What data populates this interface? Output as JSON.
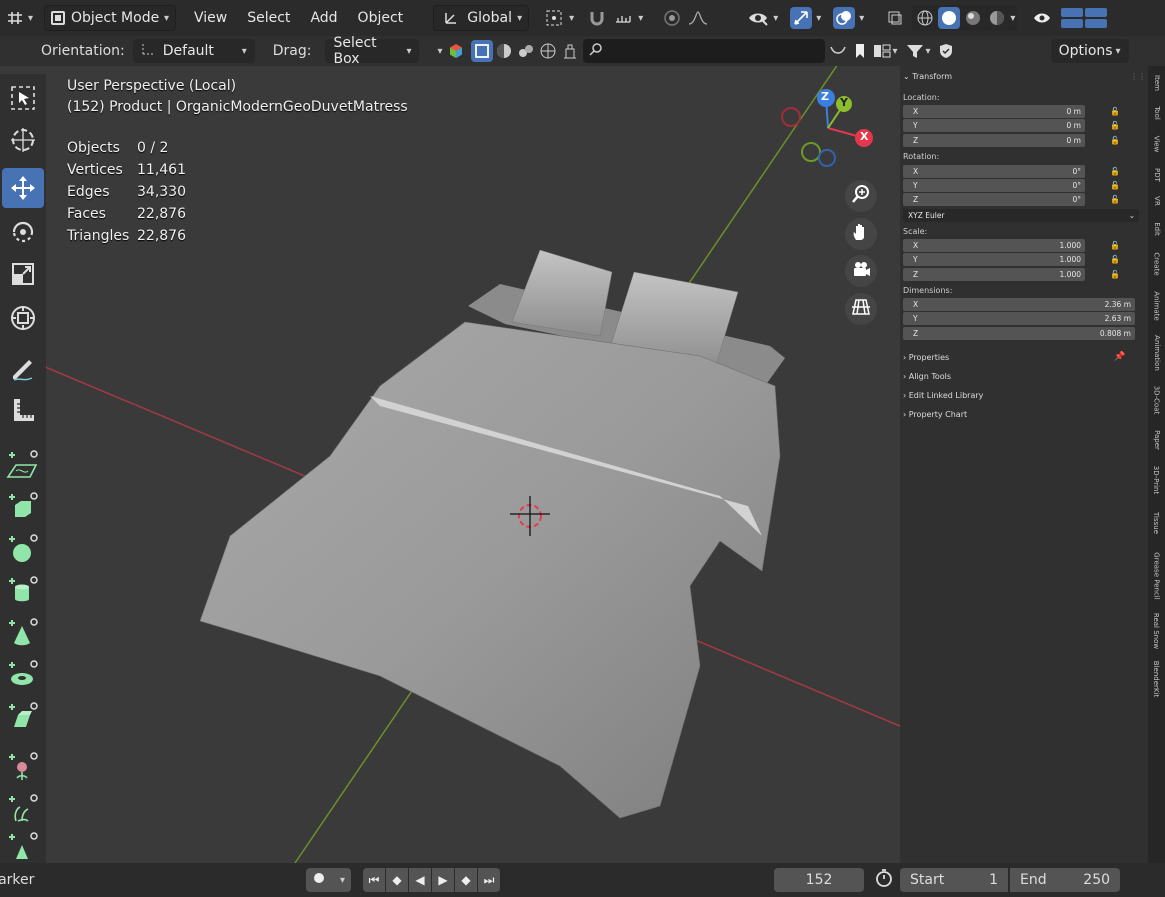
{
  "header": {
    "editor_icon": "editor-type-icon",
    "mode": "Object Mode",
    "menus": [
      "View",
      "Select",
      "Add",
      "Object"
    ],
    "orientation_global": "Global",
    "options": "Options"
  },
  "toolbar": {
    "orientation_label": "Orientation:",
    "orientation_value": "Default",
    "drag_label": "Drag:",
    "drag_value": "Select Box",
    "search_placeholder": ""
  },
  "viewport": {
    "perspective": "User Perspective (Local)",
    "object_info": "(152) Product | OrganicModernGeoDuvetMatress",
    "stats": [
      {
        "k": "Objects",
        "v": "0 / 2"
      },
      {
        "k": "Vertices",
        "v": "11,461"
      },
      {
        "k": "Edges",
        "v": "34,330"
      },
      {
        "k": "Faces",
        "v": "22,876"
      },
      {
        "k": "Triangles",
        "v": "22,876"
      }
    ],
    "gizmo_axes": [
      "Z",
      "Y",
      "X"
    ]
  },
  "npanel": {
    "transform": "Transform",
    "location_label": "Location:",
    "rotation_label": "Rotation:",
    "scale_label": "Scale:",
    "dimensions_label": "Dimensions:",
    "euler": "XYZ Euler",
    "location": [
      {
        "a": "X",
        "v": "0 m"
      },
      {
        "a": "Y",
        "v": "0 m"
      },
      {
        "a": "Z",
        "v": "0 m"
      }
    ],
    "rotation": [
      {
        "a": "X",
        "v": "0°"
      },
      {
        "a": "Y",
        "v": "0°"
      },
      {
        "a": "Z",
        "v": "0°"
      }
    ],
    "scale": [
      {
        "a": "X",
        "v": "1.000"
      },
      {
        "a": "Y",
        "v": "1.000"
      },
      {
        "a": "Z",
        "v": "1.000"
      }
    ],
    "dimensions": [
      {
        "a": "X",
        "v": "2.36 m"
      },
      {
        "a": "Y",
        "v": "2.63 m"
      },
      {
        "a": "Z",
        "v": "0.808 m"
      }
    ],
    "sections": [
      "Properties",
      "Align Tools",
      "Edit Linked Library",
      "Property Chart"
    ]
  },
  "side_tabs": [
    "Item",
    "Tool",
    "View",
    "PDT",
    "VR",
    "Edit",
    "Create",
    "Animate",
    "Animation",
    "3D-Coat",
    "Paper",
    "3D-Print",
    "Tissue",
    "Grease Pencil",
    "Real Snow",
    "BlenderKit"
  ],
  "timeline": {
    "marker": "Marker",
    "current_frame": "152",
    "start_label": "Start",
    "start_value": "1",
    "end_label": "End",
    "end_value": "250"
  },
  "colors": {
    "accent": "#4772b3",
    "x_axis": "#e5374c",
    "y_axis": "#8bbd2c",
    "z_axis": "#3a7fe0"
  }
}
